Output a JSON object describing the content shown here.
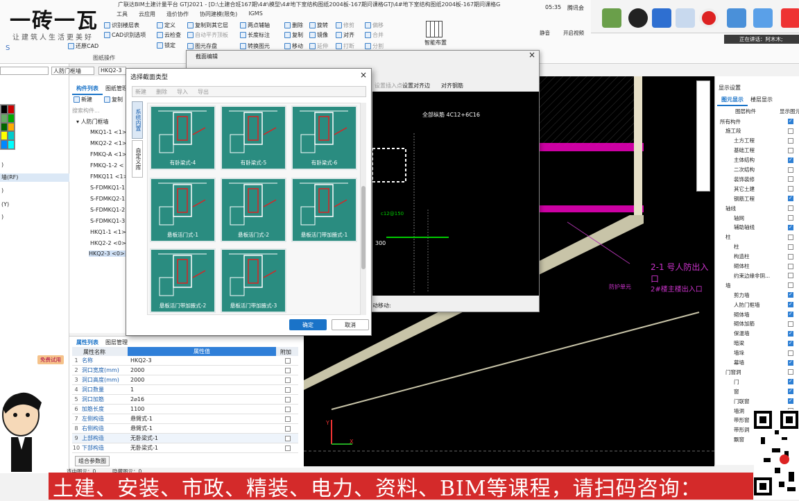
{
  "brand": {
    "logo": "一砖一瓦",
    "slogan": "让建筑人生活更美好"
  },
  "window": {
    "title": "广联达BIM土建计量平台 GTJ2021 - [D:\\土建合班167期\\4#\\模型\\4#地下室结构图纸2004板-167期问课格GTJ\\4#地下室结构图纸2004板-167期问课格G"
  },
  "menu": [
    "工具",
    "云应用",
    "造价协作",
    "协同建模(限免)",
    "IGMS"
  ],
  "ribbon": {
    "items": [
      "识别楼层表",
      "CAD识别选项",
      "还原CAD",
      "定义",
      "云检查",
      "锁定",
      "复制到其它层",
      "自动平齐顶板",
      "图元存盘",
      "两点辅轴",
      "长度标注",
      "转换图元",
      "删除",
      "复制",
      "移动",
      "旋转",
      "镜像",
      "修剪",
      "对齐",
      "延伸",
      "打断",
      "偏移",
      "合并",
      "分割",
      "智能布置"
    ],
    "group_label": "图纸操作"
  },
  "meeting": {
    "time": "05:35",
    "app": "腾讯会",
    "mute": "静音",
    "video": "开启视频",
    "speaking": "正在讲话：阿木木;"
  },
  "left_selectors": {
    "floor": "人防门框墙",
    "component": "HKQ2-3"
  },
  "left_list": [
    ")",
    "墙(RF)",
    ")",
    "(Y)",
    ")"
  ],
  "trial_badge": "免费试用",
  "component_panel": {
    "tabs": [
      "构件列表",
      "图纸管理"
    ],
    "toolbar": [
      "新建",
      "复制"
    ],
    "search_placeholder": "搜索构件...",
    "group": "人防门框墙",
    "items": [
      "MKQ1-1 <1>",
      "MKQ2-2 <1>",
      "FMKQ-A <1>",
      "FMKQ-1-2 <",
      "FMKQ11 <1>",
      "S-FDMKQ1-1",
      "S-FDMKQ2-1",
      "S-FDMKQ1-2",
      "S-FDMKQ1-3",
      "HKQ1-1 <1>",
      "HKQ2-2 <0>",
      "HKQ2-3 <0>"
    ]
  },
  "property_panel": {
    "tabs": [
      "属性列表",
      "图层管理"
    ],
    "headers": [
      "属性名称",
      "属性值",
      "附加"
    ],
    "rows": [
      {
        "num": "1",
        "name": "名称",
        "value": "HKQ2-3"
      },
      {
        "num": "2",
        "name": "洞口宽度(mm)",
        "value": "2000"
      },
      {
        "num": "3",
        "name": "洞口高度(mm)",
        "value": "2000"
      },
      {
        "num": "4",
        "name": "洞口数量",
        "value": "1"
      },
      {
        "num": "5",
        "name": "洞口加筋",
        "value": "2⌀16"
      },
      {
        "num": "6",
        "name": "加筋长度",
        "value": "1100"
      },
      {
        "num": "7",
        "name": "左侧构造",
        "value": "悬臂式-1"
      },
      {
        "num": "8",
        "name": "右侧构造",
        "value": "悬臂式-1"
      },
      {
        "num": "9",
        "name": "上部构造",
        "value": "无卧梁式-1"
      },
      {
        "num": "10",
        "name": "下部构造",
        "value": "无卧梁式-1"
      }
    ],
    "combine_button": "组合参数图"
  },
  "section_edit_dialog": {
    "title": "截面编辑",
    "toolbar": [
      "设置插入点",
      "设置对齐边",
      "对齐钢筋"
    ],
    "annotation": "全部纵筋 4C12+6C16",
    "rebar_label": "c12@150",
    "dim_label": "300",
    "status": "动移动:"
  },
  "select_dialog": {
    "title": "选择截面类型",
    "toolbar": [
      "新建",
      "删除",
      "导入",
      "导出"
    ],
    "side_tabs": [
      "系统内置",
      "自定义库"
    ],
    "tiles": [
      "有卧梁式-4",
      "有卧梁式-5",
      "有卧梁式-6",
      "悬板活门式-1",
      "悬板活门式-2",
      "悬板活门带加腋式-1",
      "悬板活门带加腋式-2",
      "悬板活门带加腋式-3"
    ],
    "ok": "确定",
    "cancel": "取消"
  },
  "canvas_labels": {
    "axis_y": "Y",
    "axis_x": "X",
    "cad_text1": "2-1 号人防出入口",
    "cad_text2": "2#楼主楼出入口",
    "cad_text3": "防护单元"
  },
  "display_settings": {
    "title": "显示设置",
    "tabs": [
      "图元显示",
      "楼层显示"
    ],
    "headers": [
      "图层构件",
      "显示图元"
    ],
    "rows": [
      {
        "label": "所有构件",
        "level": 0,
        "checked": true
      },
      {
        "label": "施工段",
        "level": 1,
        "checked": false
      },
      {
        "label": "土方工程",
        "level": 2,
        "checked": false
      },
      {
        "label": "基础工程",
        "level": 2,
        "checked": false
      },
      {
        "label": "主体结构",
        "level": 2,
        "checked": true
      },
      {
        "label": "二次结构",
        "level": 2,
        "checked": false
      },
      {
        "label": "装饰装修",
        "level": 2,
        "checked": false
      },
      {
        "label": "其它土建",
        "level": 2,
        "checked": false
      },
      {
        "label": "钢筋工程",
        "level": 2,
        "checked": true
      },
      {
        "label": "轴线",
        "level": 1,
        "checked": false
      },
      {
        "label": "轴网",
        "level": 2,
        "checked": false
      },
      {
        "label": "辅助轴线",
        "level": 2,
        "checked": true
      },
      {
        "label": "柱",
        "level": 1,
        "checked": false
      },
      {
        "label": "柱",
        "level": 2,
        "checked": false
      },
      {
        "label": "构造柱",
        "level": 2,
        "checked": false
      },
      {
        "label": "砌体柱",
        "level": 2,
        "checked": false
      },
      {
        "label": "约束边缘非阴...",
        "level": 2,
        "checked": false
      },
      {
        "label": "墙",
        "level": 1,
        "checked": false
      },
      {
        "label": "剪力墙",
        "level": 2,
        "checked": true
      },
      {
        "label": "人防门框墙",
        "level": 2,
        "checked": true
      },
      {
        "label": "砌体墙",
        "level": 2,
        "checked": true
      },
      {
        "label": "砌体加筋",
        "level": 2,
        "checked": false
      },
      {
        "label": "保温墙",
        "level": 2,
        "checked": true
      },
      {
        "label": "暗梁",
        "level": 2,
        "checked": true
      },
      {
        "label": "墙垛",
        "level": 2,
        "checked": false
      },
      {
        "label": "幕墙",
        "level": 2,
        "checked": true
      },
      {
        "label": "门窗洞",
        "level": 1,
        "checked": false
      },
      {
        "label": "门",
        "level": 2,
        "checked": true
      },
      {
        "label": "窗",
        "level": 2,
        "checked": true
      },
      {
        "label": "门联窗",
        "level": 2,
        "checked": true
      },
      {
        "label": "墙洞",
        "level": 2,
        "checked": false
      },
      {
        "label": "带形窗",
        "level": 2,
        "checked": false
      },
      {
        "label": "带形洞",
        "level": 2,
        "checked": false
      },
      {
        "label": "飘窗",
        "level": 2,
        "checked": false
      }
    ]
  },
  "statusbar": {
    "selected": "选中图元：0",
    "hidden": "隐藏图元：0"
  },
  "banner": "土建、安装、市政、精装、电力、资料、BIM等课程，请扫码咨询："
}
